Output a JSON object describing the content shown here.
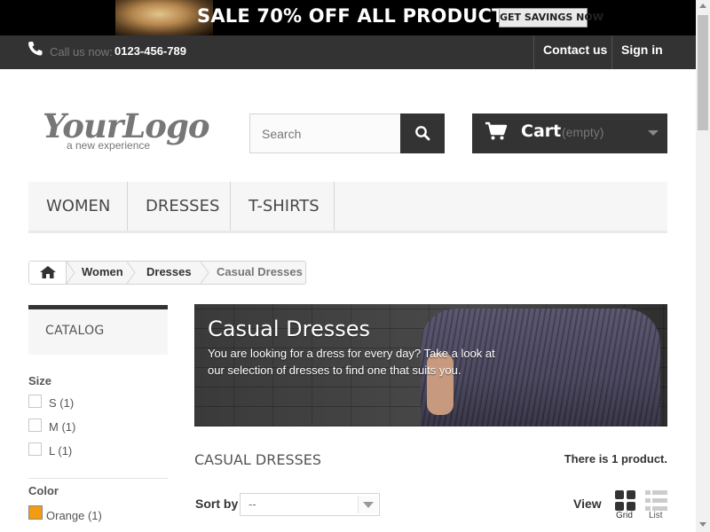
{
  "promo": {
    "text": "SALE 70% OFF ALL PRODUCTS",
    "button": "GET SAVINGS NOW"
  },
  "topbar": {
    "call_label": "Call us now:",
    "phone": "0123-456-789",
    "contact": "Contact us",
    "signin": "Sign in"
  },
  "logo": {
    "word": "YourLogo",
    "tagline": "a new experience"
  },
  "search": {
    "placeholder": "Search"
  },
  "cart": {
    "label": "Cart",
    "status": "(empty)"
  },
  "menu": {
    "items": [
      "WOMEN",
      "DRESSES",
      "T-SHIRTS"
    ]
  },
  "breadcrumb": {
    "items": [
      "Women",
      "Dresses",
      "Casual Dresses"
    ]
  },
  "sidebar": {
    "catalog": "CATALOG",
    "size_title": "Size",
    "sizes": [
      "S (1)",
      "M (1)",
      "L (1)"
    ],
    "color_title": "Color",
    "colors": [
      {
        "label": "Orange (1)",
        "hex": "#f39c11"
      }
    ]
  },
  "category": {
    "name": "Casual Dresses",
    "description": "You are looking for a dress for every day? Take a look at our selection of dresses to find one that suits you."
  },
  "listing": {
    "title": "CASUAL DRESSES",
    "count": "There is 1 product.",
    "sort_label": "Sort by",
    "sort_value": "--",
    "view_label": "View",
    "view_grid": "Grid",
    "view_list": "List"
  },
  "colors": {
    "dark": "#333333",
    "menu_bg": "#f6f6f6",
    "accent_orange": "#f39c11"
  }
}
